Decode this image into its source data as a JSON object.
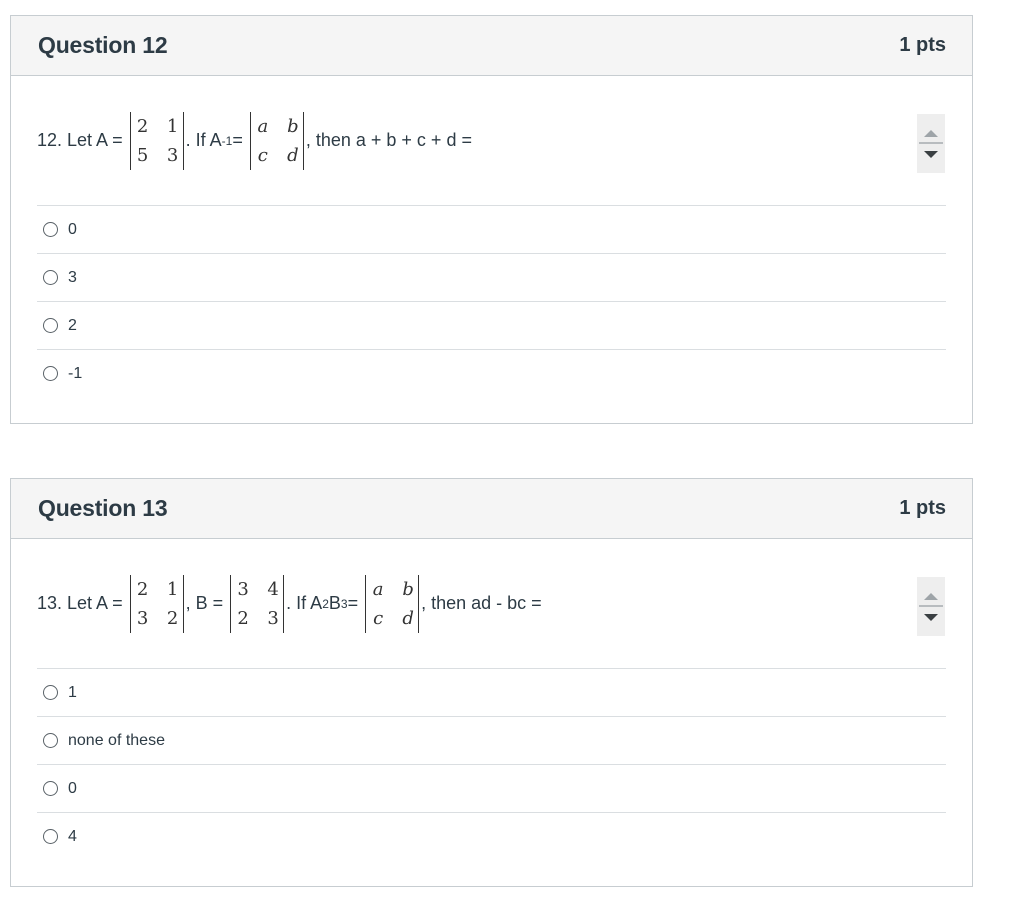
{
  "questions": [
    {
      "title": "Question 12",
      "points": "1 pts",
      "text": {
        "prefix": "12. Let A = ",
        "matrix_A": [
          [
            "2",
            "1"
          ],
          [
            "5",
            "3"
          ]
        ],
        "mid1": ". If A",
        "mid1_sup": "-1",
        "mid1_after": " = ",
        "matrix_result": [
          [
            "a",
            "b"
          ],
          [
            "c",
            "d"
          ]
        ],
        "suffix": ", then a + b + c + d ="
      },
      "answers": [
        "0",
        "3",
        "2",
        "-1"
      ]
    },
    {
      "title": "Question 13",
      "points": "1 pts",
      "text": {
        "prefix": "13. Let A = ",
        "matrix_A": [
          [
            "2",
            "1"
          ],
          [
            "3",
            "2"
          ]
        ],
        "mid0": ", B = ",
        "matrix_B": [
          [
            "3",
            "4"
          ],
          [
            "2",
            "3"
          ]
        ],
        "mid1": ". If A",
        "sup1": "2",
        "mid2": "B",
        "sup2": "3",
        "mid3": " = ",
        "matrix_result": [
          [
            "a",
            "b"
          ],
          [
            "c",
            "d"
          ]
        ],
        "suffix": ", then ad - bc ="
      },
      "answers": [
        "1",
        "none of these",
        "0",
        "4"
      ]
    }
  ]
}
